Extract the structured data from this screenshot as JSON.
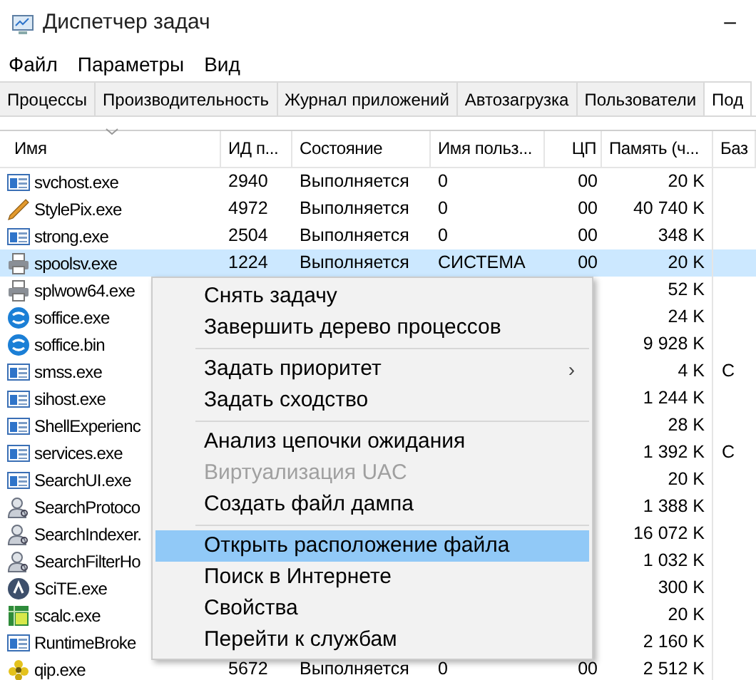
{
  "window": {
    "title": "Диспетчер задач",
    "minimize": "–"
  },
  "menu_bar": [
    "Файл",
    "Параметры",
    "Вид"
  ],
  "tabs": [
    {
      "label": "Процессы",
      "selected": false
    },
    {
      "label": "Производительность",
      "selected": false
    },
    {
      "label": "Журнал приложений",
      "selected": false
    },
    {
      "label": "Автозагрузка",
      "selected": false
    },
    {
      "label": "Пользователи",
      "selected": false
    },
    {
      "label": "Под",
      "selected": true
    }
  ],
  "table": {
    "columns": [
      "Имя",
      "ИД п...",
      "Состояние",
      "Имя польз...",
      "ЦП",
      "Память (ч...",
      "Баз"
    ],
    "rows": [
      {
        "kind": "app",
        "name": "svchost.exe",
        "pid": "2940",
        "status": "Выполняется",
        "user": "0",
        "cpu": "00",
        "memory": "20 K",
        "selected": false
      },
      {
        "kind": "pencil",
        "name": "StylePix.exe",
        "pid": "4972",
        "status": "Выполняется",
        "user": "0",
        "cpu": "00",
        "memory": "40 740 K",
        "selected": false
      },
      {
        "kind": "app",
        "name": "strong.exe",
        "pid": "2504",
        "status": "Выполняется",
        "user": "0",
        "cpu": "00",
        "memory": "348 K",
        "selected": false
      },
      {
        "kind": "printer",
        "name": "spoolsv.exe",
        "pid": "1224",
        "status": "Выполняется",
        "user": "СИСТЕМА",
        "cpu": "00",
        "memory": "20 K",
        "selected": true
      },
      {
        "kind": "printer",
        "name": "splwow64.exe",
        "memory": "52 K",
        "selected": false
      },
      {
        "kind": "office",
        "name": "soffice.exe",
        "memory": "24 K",
        "selected": false
      },
      {
        "kind": "office",
        "name": "soffice.bin",
        "memory": "9 928 K",
        "selected": false
      },
      {
        "kind": "app",
        "name": "smss.exe",
        "memory": "4 K",
        "column_7": "С",
        "selected": false
      },
      {
        "kind": "app",
        "name": "sihost.exe",
        "memory": "1 244 K",
        "selected": false
      },
      {
        "kind": "app",
        "name": "ShellExperienc",
        "memory": "28 K",
        "selected": false
      },
      {
        "kind": "app",
        "name": "services.exe",
        "memory": "1 392 K",
        "column_7": "С",
        "selected": false
      },
      {
        "kind": "app",
        "name": "SearchUI.exe",
        "memory": "20 K",
        "selected": false
      },
      {
        "kind": "search",
        "name": "SearchProtoco",
        "memory": "1 388 K",
        "selected": false
      },
      {
        "kind": "search",
        "name": "SearchIndexer.",
        "memory": "16 072 K",
        "selected": false
      },
      {
        "kind": "search",
        "name": "SearchFilterHo",
        "memory": "1 032 K",
        "selected": false
      },
      {
        "kind": "scite",
        "name": "SciTE.exe",
        "memory": "300 K",
        "selected": false
      },
      {
        "kind": "calc",
        "name": "scalc.exe",
        "memory": "20 K",
        "selected": false
      },
      {
        "kind": "app",
        "name": "RuntimeBroke",
        "memory": "2 160 K",
        "selected": false
      },
      {
        "kind": "qip",
        "name": "qip.exe",
        "pid": "5672",
        "status": "Выполняется",
        "user": "0",
        "cpu": "00",
        "memory": "2 512 K",
        "selected": false
      }
    ]
  },
  "context_menu": {
    "items": [
      {
        "kind": "item",
        "label": "Снять задачу",
        "selected": false,
        "disabled": false
      },
      {
        "kind": "item",
        "label": "Завершить дерево процессов",
        "selected": false,
        "disabled": false
      },
      {
        "kind": "separator"
      },
      {
        "kind": "item",
        "label": "Задать приоритет",
        "submenu": "›",
        "selected": false,
        "disabled": false
      },
      {
        "kind": "item",
        "label": "Задать сходство",
        "selected": false,
        "disabled": false
      },
      {
        "kind": "separator"
      },
      {
        "kind": "item",
        "label": "Анализ цепочки ожидания",
        "selected": false,
        "disabled": false
      },
      {
        "kind": "item",
        "label": "Виртуализация UAC",
        "selected": false,
        "disabled": true
      },
      {
        "kind": "item",
        "label": "Создать файл дампа",
        "selected": false,
        "disabled": false
      },
      {
        "kind": "separator"
      },
      {
        "kind": "item",
        "label": "Открыть расположение файла",
        "selected": true,
        "disabled": false
      },
      {
        "kind": "item",
        "label": "Поиск в Интернете",
        "selected": false,
        "disabled": false
      },
      {
        "kind": "item",
        "label": "Свойства",
        "selected": false,
        "disabled": false
      },
      {
        "kind": "item",
        "label": "Перейти к службам",
        "selected": false,
        "disabled": false
      }
    ]
  }
}
